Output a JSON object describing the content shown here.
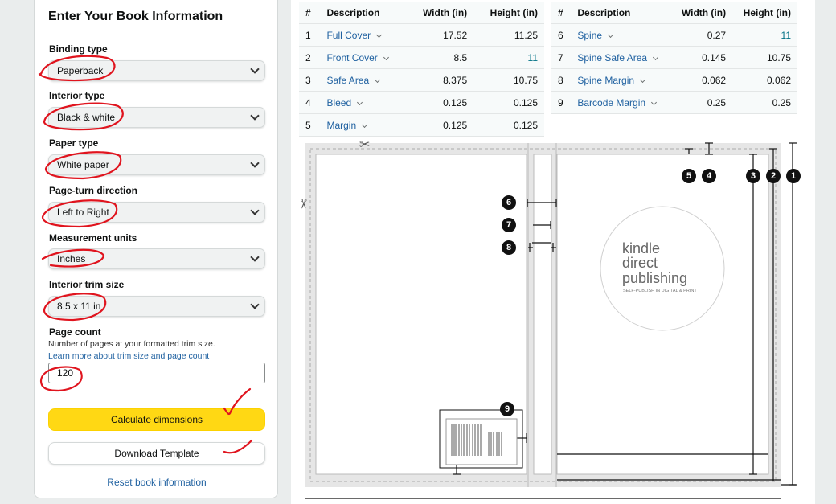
{
  "form": {
    "title": "Enter Your Book Information",
    "binding": {
      "label": "Binding type",
      "value": "Paperback"
    },
    "interior": {
      "label": "Interior type",
      "value": "Black & white"
    },
    "paper": {
      "label": "Paper type",
      "value": "White paper"
    },
    "direction": {
      "label": "Page-turn direction",
      "value": "Left to Right"
    },
    "units": {
      "label": "Measurement units",
      "value": "Inches"
    },
    "trim": {
      "label": "Interior trim size",
      "value": "8.5 x 11 in"
    },
    "pagecount": {
      "label": "Page count",
      "help": "Number of pages at your formatted trim size.",
      "link": "Learn more about trim size and page count",
      "value": "120"
    },
    "calculate_label": "Calculate dimensions",
    "download_label": "Download Template",
    "reset_label": "Reset book information"
  },
  "tables": {
    "headers": {
      "num": "#",
      "desc": "Description",
      "width": "Width (in)",
      "height": "Height (in)"
    },
    "left": [
      {
        "n": "1",
        "desc": "Full Cover",
        "w": "17.52",
        "h": "11.25"
      },
      {
        "n": "2",
        "desc": "Front Cover",
        "w": "8.5",
        "h": "11"
      },
      {
        "n": "3",
        "desc": "Safe Area",
        "w": "8.375",
        "h": "10.75"
      },
      {
        "n": "4",
        "desc": "Bleed",
        "w": "0.125",
        "h": "0.125"
      },
      {
        "n": "5",
        "desc": "Margin",
        "w": "0.125",
        "h": "0.125"
      }
    ],
    "right": [
      {
        "n": "6",
        "desc": "Spine",
        "w": "0.27",
        "h": "11"
      },
      {
        "n": "7",
        "desc": "Spine Safe Area",
        "w": "0.145",
        "h": "10.75"
      },
      {
        "n": "8",
        "desc": "Spine Margin",
        "w": "0.062",
        "h": "0.062"
      },
      {
        "n": "9",
        "desc": "Barcode Margin",
        "w": "0.25",
        "h": "0.25"
      }
    ]
  },
  "diagram": {
    "markers": [
      "1",
      "2",
      "3",
      "4",
      "5",
      "6",
      "7",
      "8",
      "9"
    ],
    "logo": {
      "line1": "kindle",
      "line2": "direct",
      "line3": "publishing",
      "tagline": "SELF-PUBLISH IN DIGITAL & PRINT"
    }
  }
}
